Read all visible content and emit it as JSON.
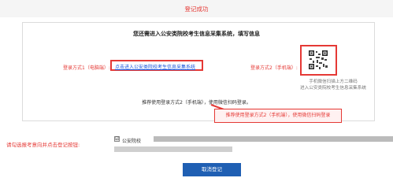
{
  "header": {
    "title": "登记成功"
  },
  "panel": {
    "prompt": "您还需进入公安类院校考生信息采集系统，填写信息",
    "method1": {
      "label": "登录方式1（电脑端）:",
      "link_text": "点击进入公安类院校考生信息采集系统"
    },
    "method2": {
      "label": "登录方式2（手机端）:",
      "qr_hint": "手机微信扫描上方二维码\n进入公安类院校考生信息采集系统"
    },
    "recommend_text": "推荐使用登录方式2（手机端），使用微信扫码登录。",
    "callout_text": "推荐使用登录方式2（手机端），使用微信扫码登录"
  },
  "selection": {
    "label": "请勾选报考意向并点击登记按钮:",
    "checkbox_symbol": "☑",
    "school": "公安院校"
  },
  "actions": {
    "cancel_label": "取消登记"
  },
  "colors": {
    "accent_red": "#e53935",
    "button_blue": "#1f5fb3",
    "link_blue": "#1a56db"
  }
}
